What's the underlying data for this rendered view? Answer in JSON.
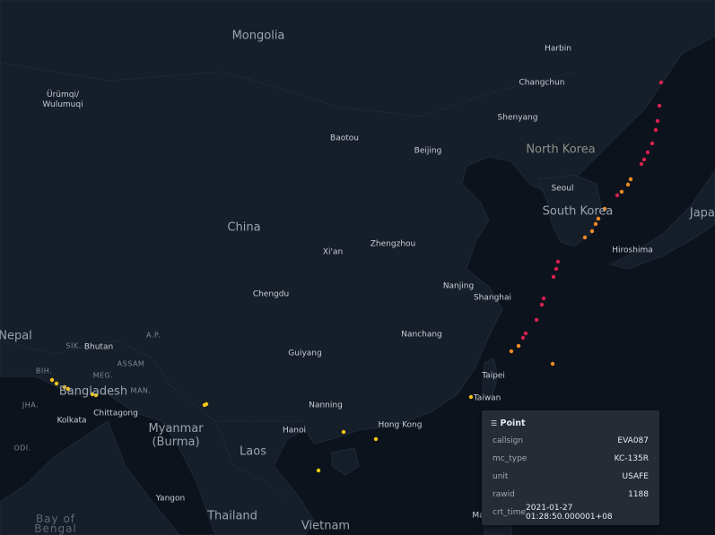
{
  "map": {
    "labels": {
      "countries": [
        "Mongolia",
        "China",
        "Nepal",
        "Bangladesh",
        "Myanmar\n(Burma)",
        "Laos",
        "Thailand",
        "Vietnam",
        "North Korea",
        "South Korea",
        "Japan"
      ],
      "cities": [
        "Harbin",
        "Changchun",
        "Shenyang",
        "Baotou",
        "Beijing",
        "Seoul",
        "Ürümqi/\nWulumuqi",
        "Zhengzhou",
        "Xi'an",
        "Hiroshima",
        "Nanjing",
        "Shanghai",
        "Chengdu",
        "Nanchang",
        "Guiyang",
        "Bhutan",
        "Taipei",
        "Taiwan",
        "Kolkata",
        "Chittagong",
        "Nanning",
        "Hong Kong",
        "Hanoi",
        "Yangon",
        "Ma"
      ],
      "regions": [
        "SIK.",
        "A.P.",
        "ASSAM",
        "BIH.",
        "MEG.",
        "MAN.",
        "JHA.",
        "ODI."
      ],
      "seas": [
        "Bay of\nBengal"
      ]
    },
    "point_colors": {
      "low": "#f5c518",
      "mid": "#f08a24",
      "high": "#d6204e"
    }
  },
  "tooltip": {
    "icon": "layer-icon",
    "title": "Point",
    "rows": [
      {
        "key": "callsign",
        "value": "EVA087"
      },
      {
        "key": "mc_type",
        "value": "KC-135R"
      },
      {
        "key": "unit",
        "value": "USAFE"
      },
      {
        "key": "rawid",
        "value": "1188"
      },
      {
        "key": "crt_time",
        "value": "2021-01-27 01:28:50.000001+08"
      }
    ]
  }
}
